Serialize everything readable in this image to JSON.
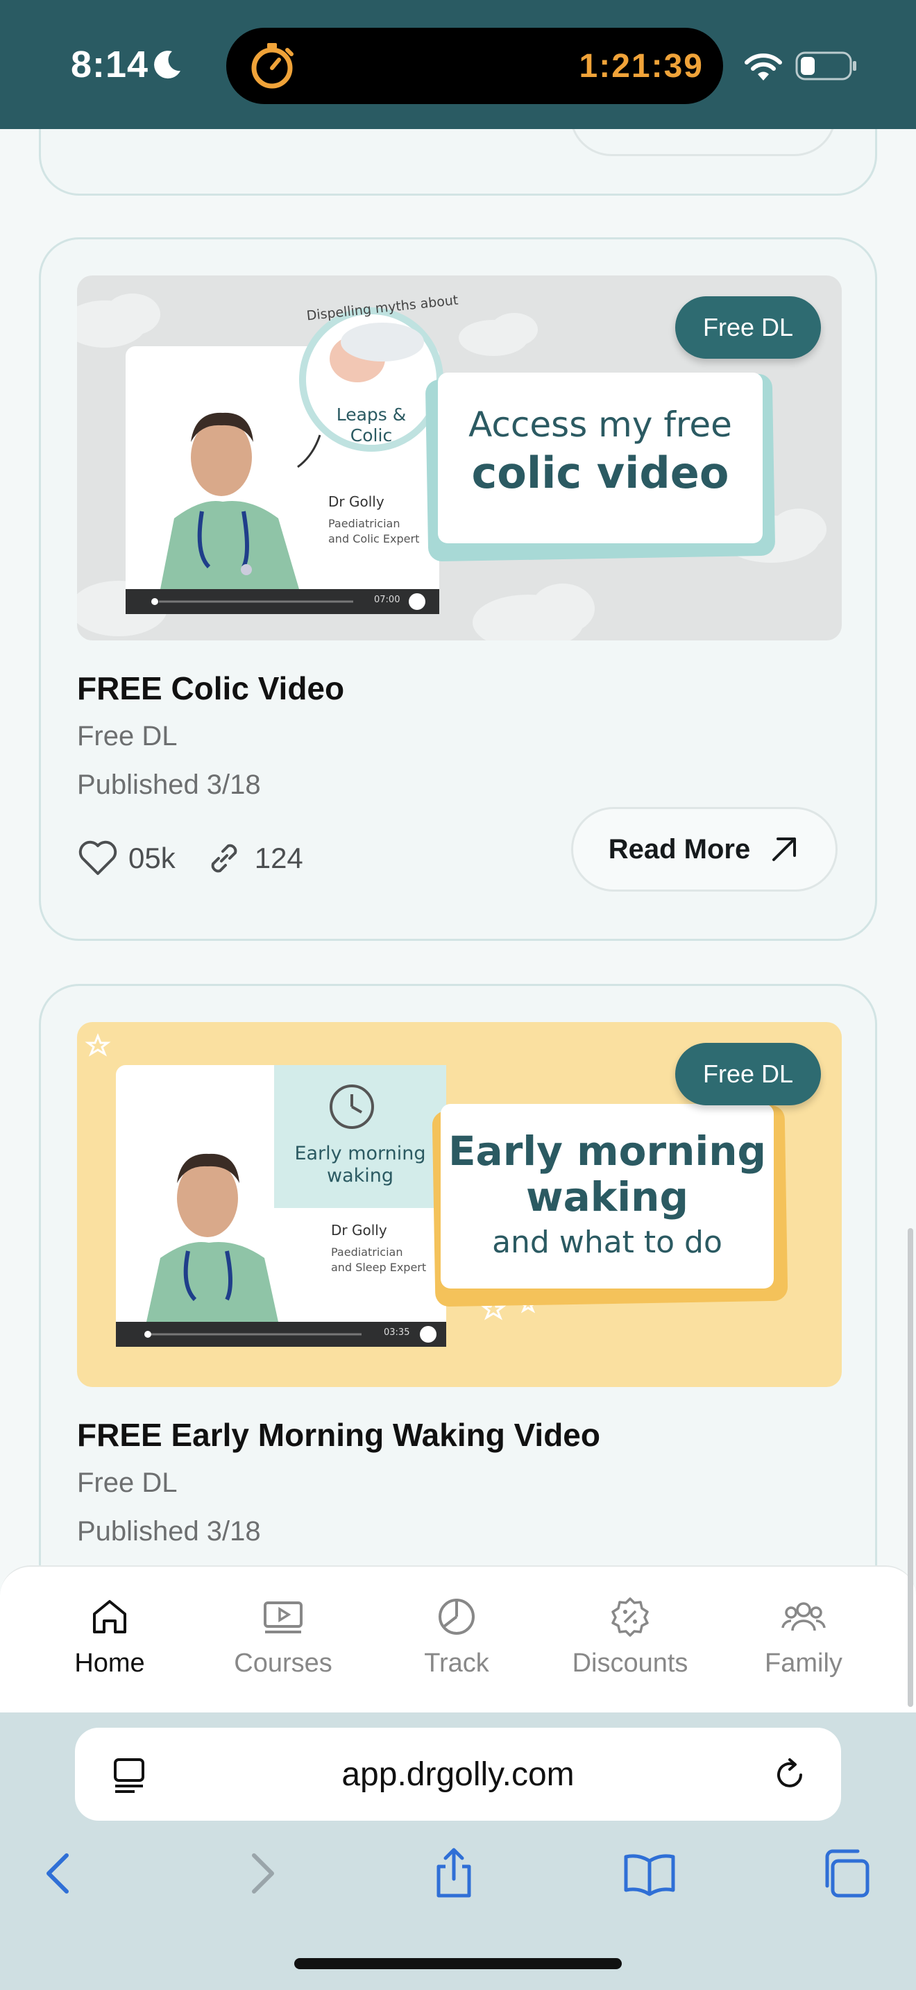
{
  "status_bar": {
    "time": "8:14",
    "island_timer": "1:21:39",
    "moon_icon": "moon-icon",
    "wifi_icon": "wifi-icon",
    "battery_icon": "battery-icon",
    "colors": {
      "bar_bg": "#2a5b63",
      "timer": "#f0a339"
    }
  },
  "feed": {
    "cards": [
      {
        "title": "FREE Colic Video",
        "category": "Free DL",
        "published": "Published 3/18",
        "likes": "05k",
        "shares": "124",
        "read_more": "Read More",
        "thumbnail": {
          "badge": "Free DL",
          "arc_text": "Dispelling myths about",
          "circle_text_1": "Leaps &",
          "circle_text_2": "Colic",
          "presenter": "Dr Golly",
          "presenter_role_1": "Paediatrician",
          "presenter_role_2": "and Colic Expert",
          "player_time": "07:00",
          "headline_1": "Access my free",
          "headline_2": "colic video",
          "bg_color": "#e1e3e3"
        }
      },
      {
        "title": "FREE Early Morning Waking Video",
        "category": "Free DL",
        "published": "Published 3/18",
        "thumbnail": {
          "badge": "Free DL",
          "panel_text_1": "Early morning",
          "panel_text_2": "waking",
          "presenter": "Dr Golly",
          "presenter_role_1": "Paediatrician",
          "presenter_role_2": "and Sleep Expert",
          "player_time": "03:35",
          "headline_1": "Early morning",
          "headline_2": "waking",
          "headline_3": "and what to do",
          "bg_color": "#fae0a0"
        }
      }
    ]
  },
  "tab_bar": {
    "tabs": [
      {
        "label": "Home",
        "icon": "home-icon",
        "active": true
      },
      {
        "label": "Courses",
        "icon": "video-icon",
        "active": false
      },
      {
        "label": "Track",
        "icon": "pie-chart-icon",
        "active": false
      },
      {
        "label": "Discounts",
        "icon": "discount-badge-icon",
        "active": false
      },
      {
        "label": "Family",
        "icon": "family-icon",
        "active": false
      }
    ]
  },
  "browser": {
    "url": "app.drgolly.com",
    "tab_options_icon": "page-menu-icon",
    "reload_icon": "reload-icon",
    "back_icon": "back-icon",
    "forward_icon": "forward-icon",
    "share_icon": "share-icon",
    "bookmarks_icon": "bookmarks-icon",
    "tabs_icon": "tabs-icon",
    "accent": "#2f6fd6"
  }
}
